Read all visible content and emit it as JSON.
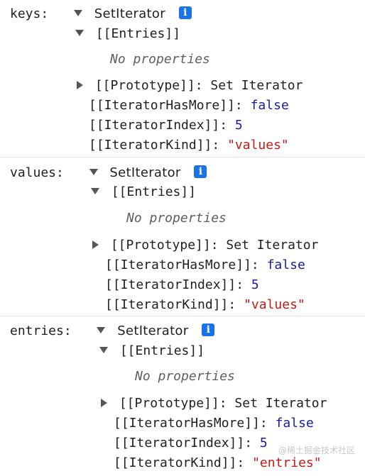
{
  "blocks": [
    {
      "key": "keys:",
      "type": "SetIterator",
      "entries_label": "[[Entries]]",
      "no_props": "No properties",
      "prototype_label": "[[Prototype]]:",
      "prototype_value": "Set Iterator",
      "has_more_label": "[[IteratorHasMore]]:",
      "has_more_value": "false",
      "index_label": "[[IteratorIndex]]:",
      "index_value": "5",
      "kind_label": "[[IteratorKind]]:",
      "kind_value": "\"values\""
    },
    {
      "key": "values:",
      "type": "SetIterator",
      "entries_label": "[[Entries]]",
      "no_props": "No properties",
      "prototype_label": "[[Prototype]]:",
      "prototype_value": "Set Iterator",
      "has_more_label": "[[IteratorHasMore]]:",
      "has_more_value": "false",
      "index_label": "[[IteratorIndex]]:",
      "index_value": "5",
      "kind_label": "[[IteratorKind]]:",
      "kind_value": "\"values\""
    },
    {
      "key": "entries:",
      "type": "SetIterator",
      "entries_label": "[[Entries]]",
      "no_props": "No properties",
      "prototype_label": "[[Prototype]]:",
      "prototype_value": "Set Iterator",
      "has_more_label": "[[IteratorHasMore]]:",
      "has_more_value": "false",
      "index_label": "[[IteratorIndex]]:",
      "index_value": "5",
      "kind_label": "[[IteratorKind]]:",
      "kind_value": "\"entries\""
    }
  ],
  "info_glyph": "i",
  "watermark": "@稀土掘金技术社区",
  "colors": {
    "keyword_blue": "#1a1aa6",
    "string_red": "#c41a16",
    "info_badge": "#1a73e8",
    "muted_italic": "#5f5f5f"
  }
}
